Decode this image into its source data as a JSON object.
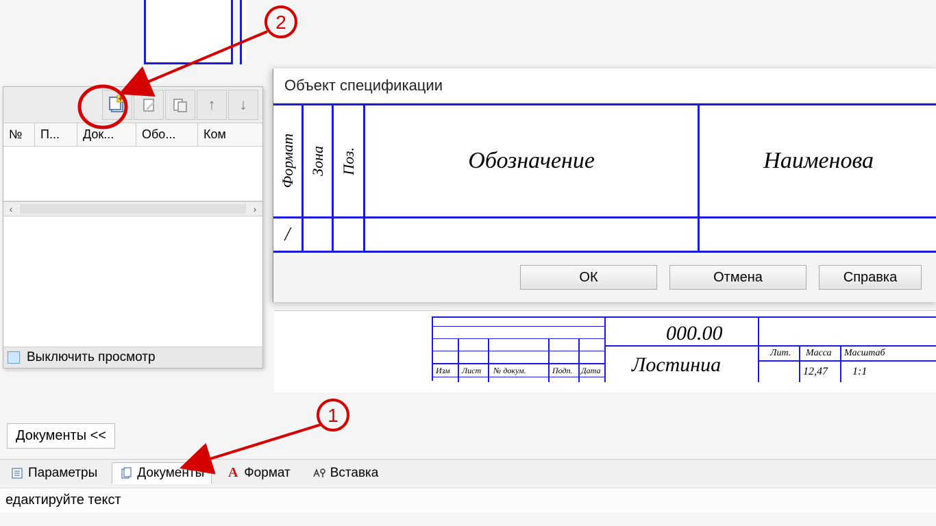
{
  "dialog": {
    "title": "Объект спецификации",
    "headers": {
      "format": "Формат",
      "zone": "Зона",
      "pos": "Поз.",
      "designation": "Обозначение",
      "name": "Наименова"
    },
    "row1_cell1": "/",
    "buttons": {
      "ok": "ОК",
      "cancel": "Отмена",
      "help": "Справка"
    }
  },
  "side": {
    "columns": [
      "№",
      "П...",
      "Док...",
      "Обо...",
      "Ком"
    ],
    "preview_toggle": "Выключить просмотр"
  },
  "docs_collapse": "Документы  <<",
  "tabs": {
    "params": "Параметры",
    "docs": "Документы",
    "format": "Формат",
    "insert": "Вставка"
  },
  "status": "едактируйте текст",
  "title_block": {
    "num": "000.00",
    "part": "Лостиниа",
    "h_izn": "Изм",
    "h_list": "Лист",
    "h_doc": "№ докум.",
    "h_sign": "Подп.",
    "h_date": "Дата",
    "h_lit": "Лит.",
    "h_mass": "Масса",
    "h_scale": "Масштаб",
    "v_scale": "1:1",
    "v_mass": "12,47"
  },
  "annotation": {
    "n1": "1",
    "n2": "2"
  }
}
